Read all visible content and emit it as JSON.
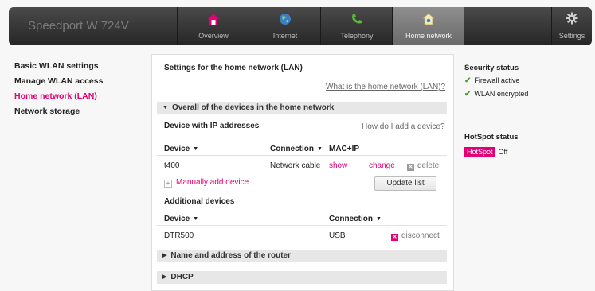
{
  "header": {
    "brand": "Speedport W 724V",
    "tabs": [
      {
        "label": "Overview",
        "icon": "house-icon"
      },
      {
        "label": "Internet",
        "icon": "globe-icon"
      },
      {
        "label": "Telephony",
        "icon": "phone-icon"
      },
      {
        "label": "Home network",
        "icon": "home-network-icon",
        "active": true
      }
    ],
    "settings_label": "Settings"
  },
  "sidebar": {
    "items": [
      {
        "label": "Basic WLAN settings"
      },
      {
        "label": "Manage WLAN access"
      },
      {
        "label": "Home network (LAN)",
        "active": true
      },
      {
        "label": "Network storage"
      }
    ]
  },
  "main": {
    "title": "Settings for the home network (LAN)",
    "help_link": "What is the home network (LAN)?",
    "section_overall": "Overall of the devices in the home network",
    "ip_devices": {
      "heading": "Device with IP addresses",
      "help_link": "How do I add a device?",
      "columns": {
        "device": "Device",
        "connection": "Connection",
        "mac_ip": "MAC+IP"
      },
      "rows": [
        {
          "device": "t400",
          "connection": "Network cable",
          "show": "show",
          "change": "change",
          "delete": "delete"
        }
      ],
      "manual_add": "Manually add device",
      "update_button": "Update list"
    },
    "additional": {
      "heading": "Additional devices",
      "columns": {
        "device": "Device",
        "connection": "Connection"
      },
      "rows": [
        {
          "device": "DTR500",
          "connection": "USB",
          "disconnect": "disconnect"
        }
      ]
    },
    "section_router": "Name and address of the router",
    "section_dhcp": "DHCP"
  },
  "status": {
    "security_heading": "Security status",
    "items": [
      "Firewall active",
      "WLAN encrypted"
    ],
    "hotspot_heading": "HotSpot status",
    "hotspot_badge": "HotSpot",
    "hotspot_value": "Off"
  },
  "colors": {
    "accent": "#e20074",
    "check": "#4aa02c"
  }
}
